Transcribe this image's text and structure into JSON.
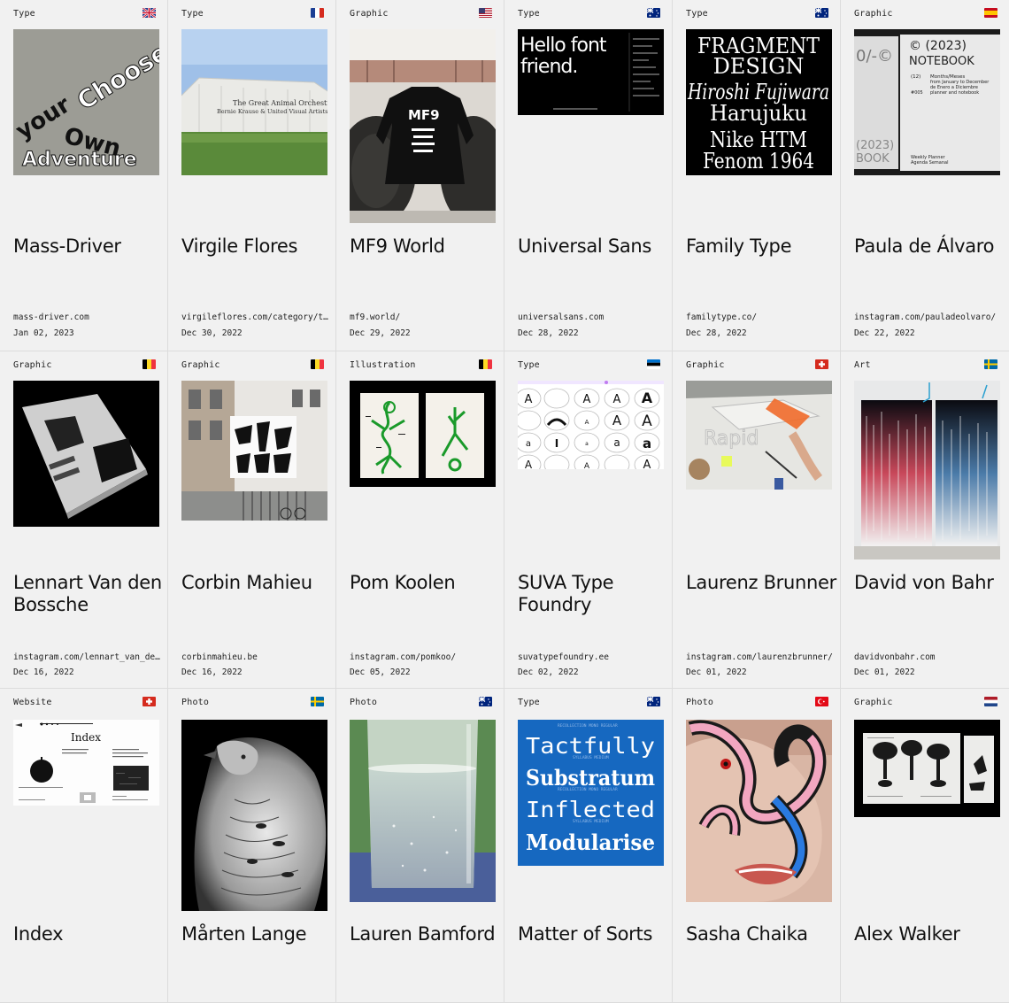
{
  "cards": [
    {
      "cat": "Type",
      "flag": "uk",
      "name": "Mass-Driver",
      "url": "mass-driver.com",
      "date": "Jan 02, 2023",
      "thumb_text": [
        "Choose",
        "your",
        "Own",
        "Adventure"
      ]
    },
    {
      "cat": "Type",
      "flag": "fr",
      "name": "Virgile Flores",
      "url": "virgileflores.com/category/t…",
      "date": "Dec 30, 2022",
      "thumb_text": [
        "The Great Animal Orchestra",
        "Bernie Krause & United Visual Artists"
      ]
    },
    {
      "cat": "Graphic",
      "flag": "us",
      "name": "MF9 World",
      "url": "mf9.world/",
      "date": "Dec 29, 2022",
      "thumb_text": [
        "MF9"
      ]
    },
    {
      "cat": "Type",
      "flag": "au",
      "name": "Universal Sans",
      "url": "universalsans.com",
      "date": "Dec 28, 2022",
      "thumb_text": [
        "Hello font",
        "friend."
      ]
    },
    {
      "cat": "Type",
      "flag": "au",
      "name": "Family Type",
      "url": "familytype.co/",
      "date": "Dec 28, 2022",
      "thumb_text": [
        "FRAGMENT",
        "DESIGN",
        "Hiroshi Fujiwara",
        "Harujuku",
        "Nike HTM",
        "Fenom 1964"
      ]
    },
    {
      "cat": "Graphic",
      "flag": "es",
      "name": "Paula de Álvaro",
      "url": "instagram.com/pauladeolvaro/",
      "date": "Dec 22, 2022",
      "thumb_text": [
        "© (2023)",
        "NOTEBOOK",
        "Months/Meses",
        "from January to December",
        "de Enero a Diciembre",
        "planner and notebook",
        "Weekly Planner",
        "Agenda Semanal"
      ]
    },
    {
      "cat": "Graphic",
      "flag": "be",
      "name": "Lennart Van den Bossche",
      "url": "instagram.com/lennart_van_de…",
      "date": "Dec 16, 2022"
    },
    {
      "cat": "Graphic",
      "flag": "be",
      "name": "Corbin Mahieu",
      "url": "corbinmahieu.be",
      "date": "Dec 16, 2022"
    },
    {
      "cat": "Illustration",
      "flag": "be",
      "name": "Pom Koolen",
      "url": "instagram.com/pomkoo/",
      "date": "Dec 05, 2022"
    },
    {
      "cat": "Type",
      "flag": "ee",
      "name": "SUVA Type Foundry",
      "url": "suvatypefoundry.ee",
      "date": "Dec 02, 2022"
    },
    {
      "cat": "Graphic",
      "flag": "ch",
      "name": "Laurenz Brunner",
      "url": "instagram.com/laurenzbrunner/",
      "date": "Dec 01, 2022"
    },
    {
      "cat": "Art",
      "flag": "se",
      "name": "David von Bahr",
      "url": "davidvonbahr.com",
      "date": "Dec 01, 2022"
    },
    {
      "cat": "Website",
      "flag": "ch",
      "name": "Index",
      "url": "",
      "date": "",
      "thumb_text": [
        "Index"
      ]
    },
    {
      "cat": "Photo",
      "flag": "se",
      "name": "Mårten Lange",
      "url": "",
      "date": ""
    },
    {
      "cat": "Photo",
      "flag": "au",
      "name": "Lauren Bamford",
      "url": "",
      "date": ""
    },
    {
      "cat": "Type",
      "flag": "au",
      "name": "Matter of Sorts",
      "url": "",
      "date": "",
      "thumb_text": [
        "Tactfully",
        "Substratum",
        "Inflected",
        "Modularise"
      ]
    },
    {
      "cat": "Photo",
      "flag": "tr",
      "name": "Sasha Chaika",
      "url": "",
      "date": ""
    },
    {
      "cat": "Graphic",
      "flag": "nl",
      "name": "Alex Walker",
      "url": "",
      "date": ""
    }
  ]
}
